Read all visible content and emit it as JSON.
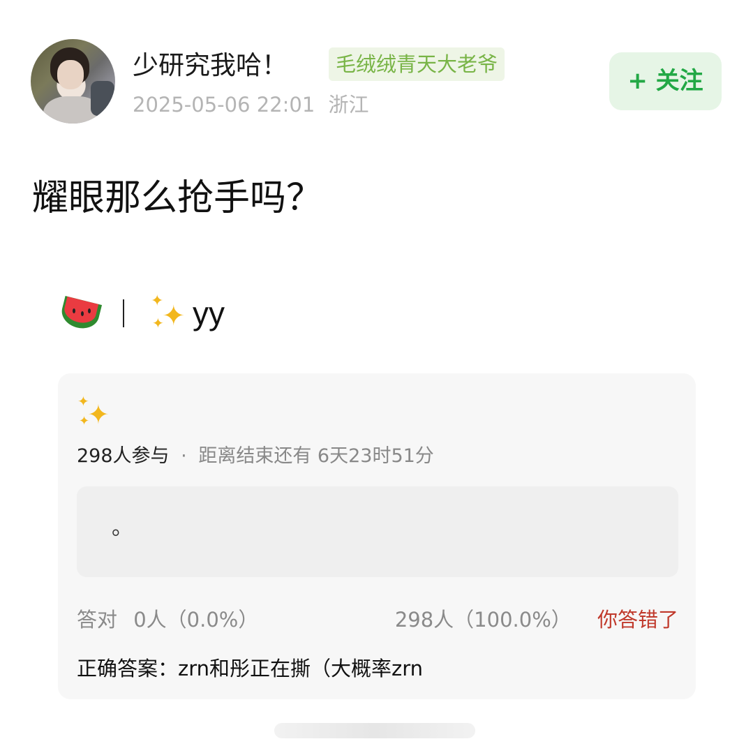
{
  "author": {
    "name": "少研究我哈！",
    "tag": "毛绒绒青天大老爷",
    "datetime": "2025-05-06 22:01",
    "location": "浙江"
  },
  "follow_button": "+ 关注",
  "post": {
    "title": "耀眼那么抢手吗？",
    "signature_text": "yy"
  },
  "quiz": {
    "participants": "298人参与",
    "separator": "·",
    "countdown": "距离结束还有 6天23时51分",
    "option_text": "。",
    "correct_label": "答对",
    "correct_stats": "0人（0.0%）",
    "wrong_stats": "298人（100.0%）",
    "wrong_label": "你答错了",
    "answer": "正确答案：zrn和彤正在撕（大概率zrn"
  },
  "colors": {
    "follow_green": "#22a845",
    "tag_green": "#78b446",
    "wrong_red": "#c0392b"
  }
}
